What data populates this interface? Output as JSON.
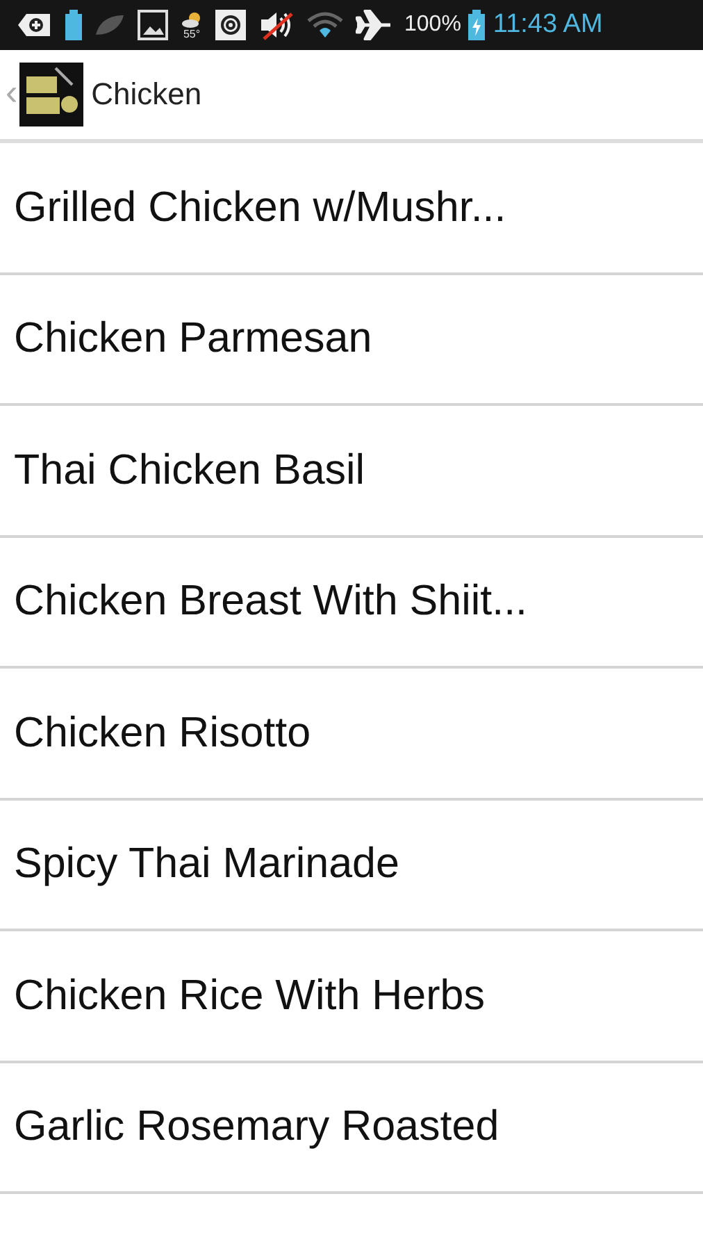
{
  "status_bar": {
    "weather_temp": "55°",
    "battery_percent": "100%",
    "time": "11:43 AM"
  },
  "header": {
    "back": "‹",
    "title": "Chicken"
  },
  "recipes": [
    {
      "name": "Grilled Chicken w/Mushr..."
    },
    {
      "name": "Chicken Parmesan"
    },
    {
      "name": "Thai Chicken Basil"
    },
    {
      "name": "Chicken Breast With Shiit..."
    },
    {
      "name": "Chicken Risotto"
    },
    {
      "name": "Spicy Thai Marinade"
    },
    {
      "name": "Chicken Rice With Herbs"
    },
    {
      "name": "Garlic Rosemary Roasted"
    }
  ]
}
